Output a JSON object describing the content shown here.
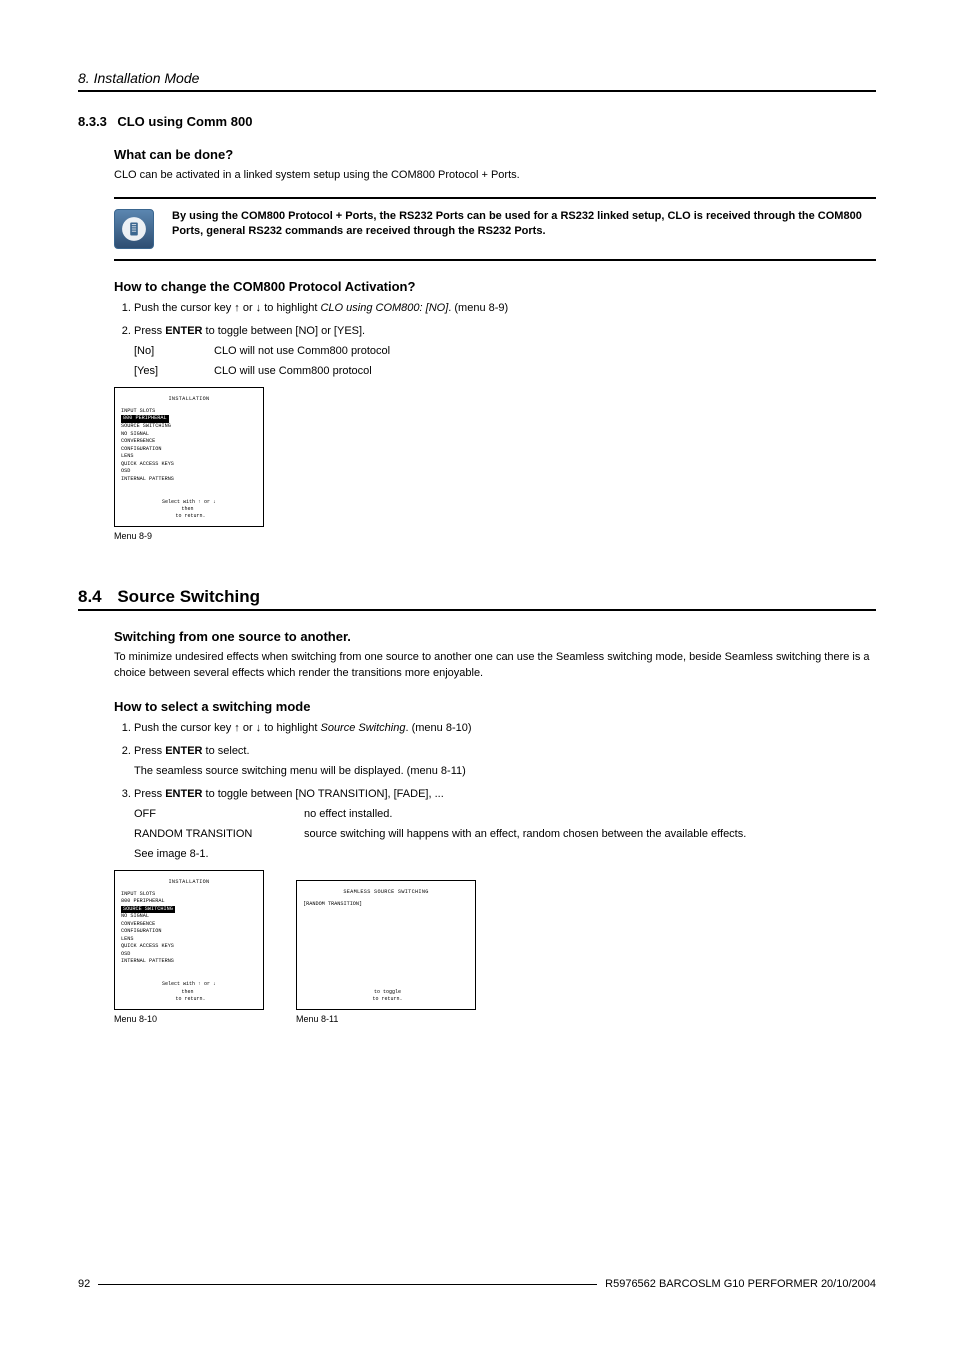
{
  "chapter": "8.  Installation Mode",
  "s833": {
    "num": "8.3.3",
    "title": "CLO using Comm 800",
    "what_heading": "What can be done?",
    "what_text": "CLO can be activated in a linked system setup using the COM800 Protocol + Ports.",
    "note": "By using the COM800 Protocol + Ports, the RS232 Ports can be used for a RS232 linked setup, CLO is received through the COM800 Ports, general RS232 commands are received through the RS232 Ports.",
    "how_heading": "How to change the COM800 Protocol Activation?",
    "step1_a": "Push the cursor key ↑ or ↓ to highlight ",
    "step1_i": "CLO using COM800: [NO]",
    "step1_b": ". (menu 8-9)",
    "step2_a": "Press ",
    "step2_enter": "ENTER",
    "step2_b": " to toggle between [NO] or [YES].",
    "opt_no_label": "[No]",
    "opt_no_desc": "CLO will not use Comm800 protocol",
    "opt_yes_label": "[Yes]",
    "opt_yes_desc": "CLO will use Comm800 protocol",
    "menu89_caption": "Menu 8-9",
    "menu89": {
      "title": "INSTALLATION",
      "lines": [
        "INPUT SLOTS",
        "800 PERIPHERAL",
        "SOURCE SWITCHING",
        "NO SIGNAL",
        "CONVERGENCE",
        "CONFIGURATION",
        "LENS",
        "QUICK ACCESS KEYS",
        "OSD",
        "INTERNAL PATTERNS"
      ],
      "highlight_index": 1,
      "hint": "Select with ↑ or ↓\nthen <ENTER>\n<EXIT> to return."
    }
  },
  "s84": {
    "num": "8.4",
    "title": "Source Switching",
    "sw_heading": "Switching from one source to another.",
    "sw_text": "To minimize undesired effects when switching from one source to another one can use the Seamless switching mode, beside Seamless switching there is a choice between several effects which render the transitions more enjoyable.",
    "how_heading": "How to select a switching mode",
    "step1_a": "Push the cursor key ↑ or ↓ to highlight ",
    "step1_i": "Source Switching",
    "step1_b": ".  (menu 8-10)",
    "step2_a": "Press ",
    "step2_enter": "ENTER",
    "step2_b": " to select.",
    "step2_sub": "The seamless source switching menu will be displayed.  (menu 8-11)",
    "step3_a": "Press ",
    "step3_enter": "ENTER",
    "step3_b": " to toggle between [NO TRANSITION], [FADE], ...",
    "eff_off_label": "OFF",
    "eff_off_desc": "no effect installed.",
    "eff_rand_label": "RANDOM TRANSITION",
    "eff_rand_desc": "source switching will happens with an effect, random chosen between the available effects.",
    "see_image": "See image 8-1.",
    "menu810_caption": "Menu 8-10",
    "menu811_caption": "Menu 8-11",
    "menu810": {
      "title": "INSTALLATION",
      "lines": [
        "INPUT SLOTS",
        "800 PERIPHERAL",
        "SOURCE SWITCHING",
        "NO SIGNAL",
        "CONVERGENCE",
        "CONFIGURATION",
        "LENS",
        "QUICK ACCESS KEYS",
        "OSD",
        "INTERNAL PATTERNS"
      ],
      "highlight_index": 2,
      "hint": "Select with ↑ or ↓\nthen <ENTER>\n<EXIT> to return."
    },
    "menu811": {
      "title": "SEAMLESS SOURCE SWITCHING",
      "lines": [
        "[RANDOM TRANSITION]"
      ],
      "highlight_index": -1,
      "hint": "<ENTER> to toggle\n<EXIT> to return."
    }
  },
  "footer": {
    "page": "92",
    "doc": "R5976562  BARCOSLM G10 PERFORMER  20/10/2004"
  }
}
